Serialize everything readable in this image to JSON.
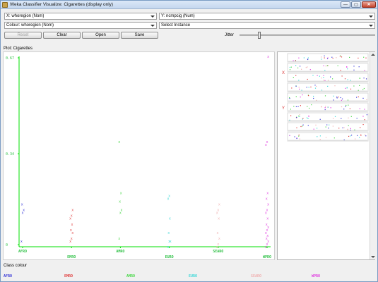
{
  "window": {
    "title": "Weka Classifier Visualize: Cigarettes (display only)",
    "minimize_glyph": "—",
    "maximize_glyph": "▢",
    "close_glyph": "✕"
  },
  "selectors": {
    "x_axis": "X: whoregion (Nom)",
    "y_axis": "Y: ncmpcig (Num)",
    "colour": "Colour: whoregion (Nom)",
    "instance": "Select Instance"
  },
  "buttons": {
    "reset": "Reset",
    "clear": "Clear",
    "open": "Open",
    "save": "Save"
  },
  "jitter": {
    "label": "Jitter",
    "value": 0.14
  },
  "plot": {
    "title": "Plot: Cigarettes"
  },
  "legend": {
    "title": "Class colour",
    "classes": [
      {
        "name": "AFRO",
        "color": "#3a3ad8"
      },
      {
        "name": "EMRO",
        "color": "#e04040"
      },
      {
        "name": "AMRO",
        "color": "#4ad84a"
      },
      {
        "name": "EURO",
        "color": "#40d8d8"
      },
      {
        "name": "SEARO",
        "color": "#f0b0b0"
      },
      {
        "name": "WPRO",
        "color": "#e040e0"
      }
    ]
  },
  "matrix": {
    "x_marker": "X",
    "y_marker": "Y"
  },
  "chart_data": {
    "type": "scatter",
    "categories": [
      "AFRO",
      "EMRO",
      "AMRO",
      "EURO",
      "SEARO",
      "WPRO"
    ],
    "y_ticks": [
      "0.67",
      "0.34",
      "0"
    ],
    "ylim": [
      0,
      0.67
    ],
    "point_marker": "x",
    "series": [
      {
        "name": "AFRO",
        "color": "#3a3ad8",
        "values": [
          0.02,
          0.12,
          0.13,
          0.15
        ]
      },
      {
        "name": "EMRO",
        "color": "#e04040",
        "values": [
          0.02,
          0.03,
          0.05,
          0.06,
          0.08,
          0.1,
          0.11,
          0.13
        ]
      },
      {
        "name": "AMRO",
        "color": "#4ad84a",
        "values": [
          0.03,
          0.12,
          0.13,
          0.16,
          0.19,
          0.37
        ]
      },
      {
        "name": "EURO",
        "color": "#40d8d8",
        "values": [
          0.0,
          0.02,
          0.02,
          0.05,
          0.1,
          0.17,
          0.18
        ]
      },
      {
        "name": "SEARO",
        "color": "#f0b0b0",
        "values": [
          0.0,
          0.01,
          0.03,
          0.05,
          0.1,
          0.12,
          0.13,
          0.15
        ]
      },
      {
        "name": "WPRO",
        "color": "#e040e0",
        "values": [
          0.0,
          0.01,
          0.02,
          0.03,
          0.04,
          0.05,
          0.06,
          0.07,
          0.08,
          0.1,
          0.12,
          0.13,
          0.15,
          0.17,
          0.19,
          0.36,
          0.37,
          0.67
        ]
      }
    ]
  }
}
